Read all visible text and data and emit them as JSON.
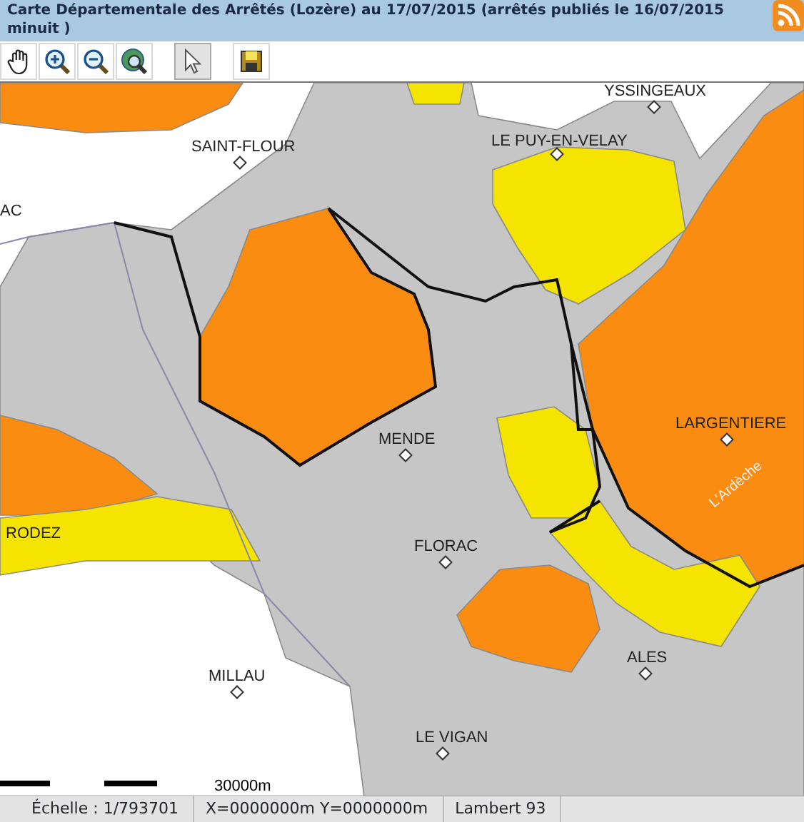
{
  "title": "Carte Départementale des Arrêtés (Lozère) au 17/07/2015 (arrêtés publiés le 16/07/2015 minuit )",
  "toolbar": [
    {
      "kind": "pan",
      "selected": false
    },
    {
      "kind": "zoom-in",
      "selected": false
    },
    {
      "kind": "zoom-out",
      "selected": false
    },
    {
      "kind": "full-extent",
      "selected": false
    },
    {
      "kind": "select",
      "selected": true
    },
    {
      "kind": "save",
      "selected": false
    }
  ],
  "map": {
    "labels": [
      {
        "text": "YSSINGEAUX",
        "kind": "city"
      },
      {
        "text": "SAINT-FLOUR",
        "kind": "city"
      },
      {
        "text": "LE PUY-EN-VELAY",
        "kind": "city"
      },
      {
        "text": "AC",
        "kind": "plain"
      },
      {
        "text": "MENDE",
        "kind": "city"
      },
      {
        "text": "LARGENTIERE",
        "kind": "city"
      },
      {
        "text": "L'Ardèche",
        "kind": "river"
      },
      {
        "text": "RODEZ",
        "kind": "plain"
      },
      {
        "text": "FLORAC",
        "kind": "city"
      },
      {
        "text": "ALES",
        "kind": "city"
      },
      {
        "text": "MILLAU",
        "kind": "city"
      },
      {
        "text": "LE VIGAN",
        "kind": "city"
      }
    ],
    "scale_label": "30000m"
  },
  "status_bar": {
    "scale": "Échelle : 1/793701",
    "coordinates": "X=0000000m Y=0000000m",
    "projection": "Lambert 93"
  }
}
